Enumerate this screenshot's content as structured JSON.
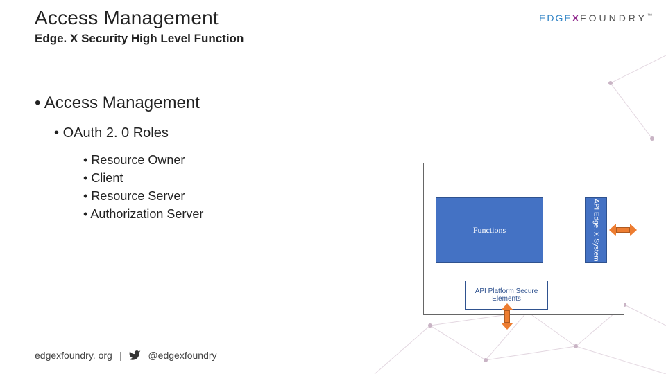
{
  "header": {
    "title": "Access Management",
    "subtitle": "Edge. X Security High Level Function"
  },
  "logo": {
    "part_edge": "EDGE",
    "part_x": "X",
    "part_foundry": "FOUNDRY",
    "tm": "™"
  },
  "content": {
    "lvl1": "Access Management",
    "lvl2": "OAuth 2. 0 Roles",
    "items": [
      "Resource Owner",
      "Client",
      "Resource Server",
      "Authorization Server"
    ]
  },
  "diagram": {
    "functions_label": "Functions",
    "api_system_label": "API\nEdge. X\nSystem",
    "api_platform_label": "API\nPlatform Secure\nElements"
  },
  "footer": {
    "site": "edgexfoundry. org",
    "separator": "|",
    "handle": "@edgexfoundry"
  }
}
